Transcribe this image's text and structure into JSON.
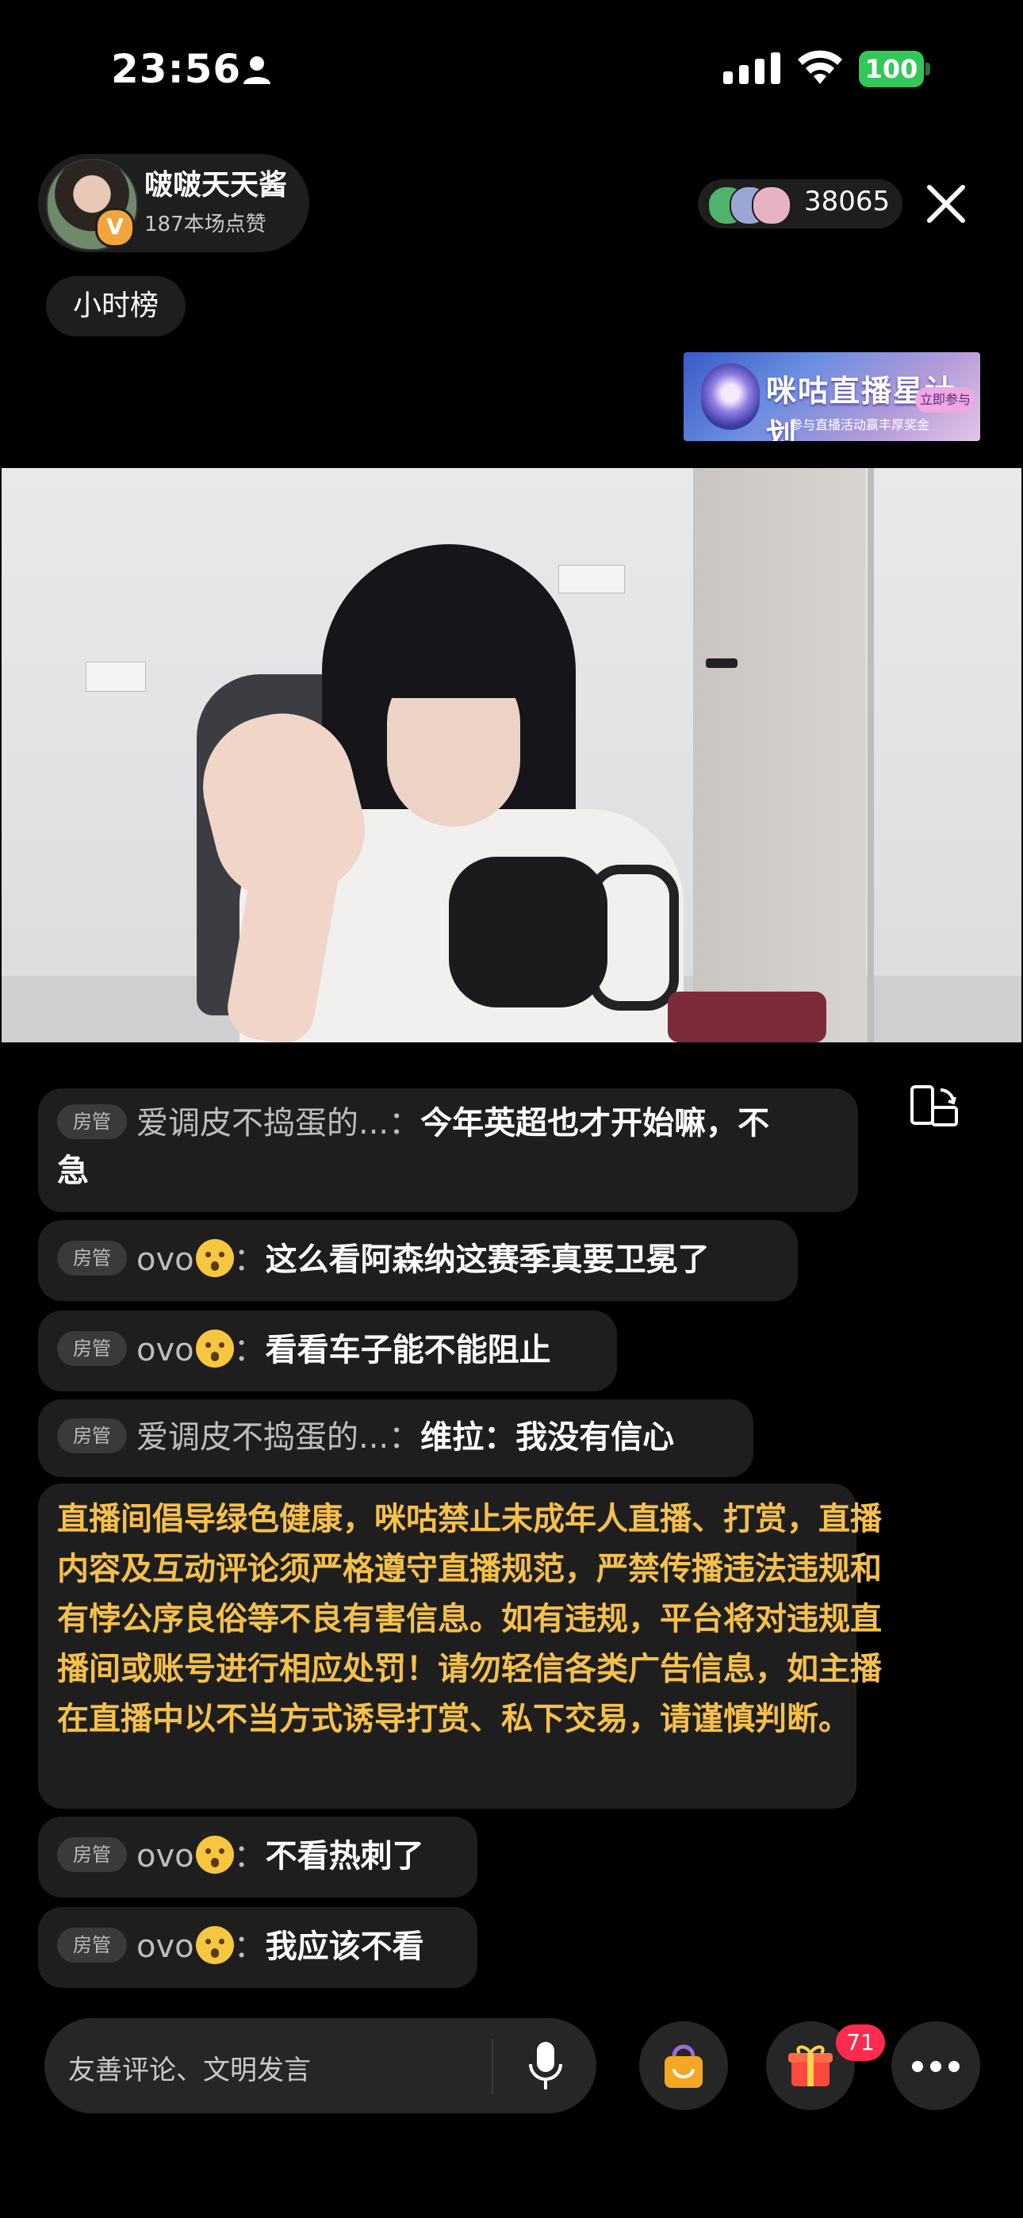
{
  "status_bar": {
    "time": "23:56",
    "battery": "100",
    "battery_color": "#33c759"
  },
  "anchor": {
    "name": "啵啵天天酱",
    "likes": "187本场点赞",
    "badge": "V"
  },
  "viewers": {
    "count": "38065"
  },
  "hour_rank": {
    "label": "小时榜"
  },
  "banner": {
    "title": "咪咕直播星计划",
    "subtitle": "参与直播活动赢丰厚奖金",
    "tag": "立即参与"
  },
  "chat": {
    "messages": [
      {
        "role": "房管",
        "user": "爱调皮不捣蛋的...",
        "sep": "：",
        "text_line1": "今年英超也才开始嘛，不",
        "text_line2": "急"
      },
      {
        "role": "房管",
        "user": "ovo",
        "sep": "：",
        "text": "这么看阿森纳这赛季真要卫冕了"
      },
      {
        "role": "房管",
        "user": "ovo",
        "sep": "：",
        "text": "看看车子能不能阻止"
      },
      {
        "role": "房管",
        "user": "爱调皮不捣蛋的...",
        "sep": "：",
        "text": "维拉：我没有信心"
      },
      {
        "role": "房管",
        "user": "ovo",
        "sep": "：",
        "text": "不看热刺了"
      },
      {
        "role": "房管",
        "user": "ovo",
        "sep": "：",
        "text": "我应该不看"
      }
    ],
    "notice": "直播间倡导绿色健康，咪咕禁止未成年人直播、打赏，直播内容及互动评论须严格遵守直播规范，严禁传播违法违规和有悖公序良俗等不良有害信息。如有违规，平台将对违规直播间或账号进行相应处罚！请勿轻信各类广告信息，如主播在直播中以不当方式诱导打赏、私下交易，请谨慎判断。",
    "notice_color": "#f5c04a"
  },
  "bottom_bar": {
    "input_placeholder": "友善评论、文明发言",
    "gift_count": "71",
    "icons": [
      "mic-icon",
      "shopping-bag-icon",
      "gift-icon",
      "more-icon"
    ]
  }
}
